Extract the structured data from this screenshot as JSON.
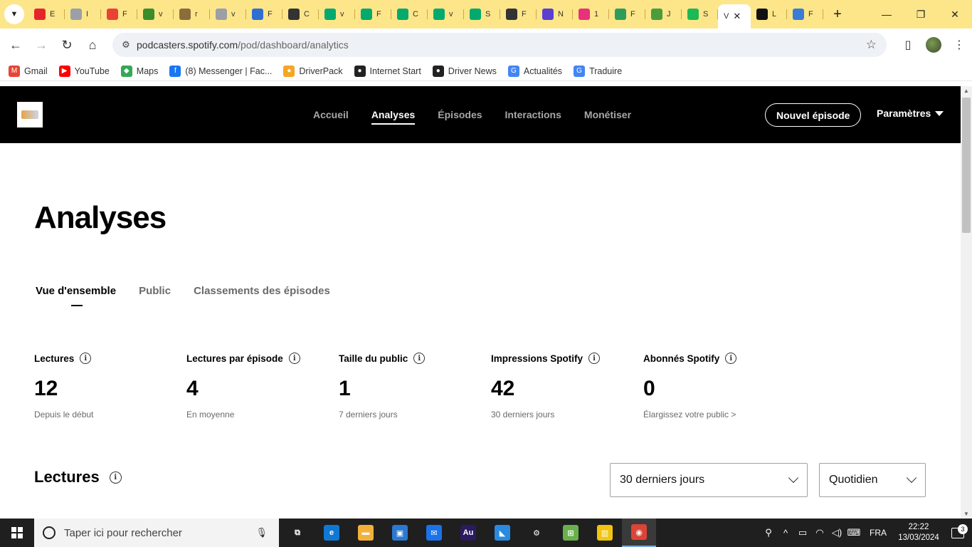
{
  "browser": {
    "tabs": [
      {
        "letter": "E",
        "color": "#e4262b"
      },
      {
        "letter": "I",
        "color": "#9aa0a6"
      },
      {
        "letter": "F",
        "color": "#ea4335"
      },
      {
        "letter": "v",
        "color": "#3a8d2a"
      },
      {
        "letter": "r",
        "color": "#8a6d3b"
      },
      {
        "letter": "v",
        "color": "#9aa0a6"
      },
      {
        "letter": "F",
        "color": "#2f6fd1"
      },
      {
        "letter": "C",
        "color": "#333333"
      },
      {
        "letter": "v",
        "color": "#04aa6d"
      },
      {
        "letter": "F",
        "color": "#04aa6d"
      },
      {
        "letter": "C",
        "color": "#04aa6d"
      },
      {
        "letter": "v",
        "color": "#04aa6d"
      },
      {
        "letter": "S",
        "color": "#04aa6d"
      },
      {
        "letter": "F",
        "color": "#333333"
      },
      {
        "letter": "N",
        "color": "#5b3fd1"
      },
      {
        "letter": "1",
        "color": "#e8317a"
      },
      {
        "letter": "F",
        "color": "#2e9d5c"
      },
      {
        "letter": "J",
        "color": "#4a9d3a"
      },
      {
        "letter": "S",
        "color": "#1db954"
      }
    ],
    "active_tab": {
      "letter": "V"
    },
    "tabs_after": [
      {
        "letter": "L",
        "color": "#111111"
      },
      {
        "letter": "F",
        "color": "#3a7bd5"
      }
    ],
    "url_domain": "podcasters.spotify.com",
    "url_path": "/pod/dashboard/analytics",
    "bookmarks": [
      {
        "label": "Gmail",
        "color": "#ea4335",
        "glyph": "M"
      },
      {
        "label": "YouTube",
        "color": "#ff0000",
        "glyph": "▶"
      },
      {
        "label": "Maps",
        "color": "#34a853",
        "glyph": "◆"
      },
      {
        "label": "(8) Messenger | Fac...",
        "color": "#1877f2",
        "glyph": "f"
      },
      {
        "label": "DriverPack",
        "color": "#f5a623",
        "glyph": "●"
      },
      {
        "label": "Internet Start",
        "color": "#222222",
        "glyph": "●"
      },
      {
        "label": "Driver News",
        "color": "#222222",
        "glyph": "●"
      },
      {
        "label": "Actualités",
        "color": "#4285f4",
        "glyph": "G"
      },
      {
        "label": "Traduire",
        "color": "#4285f4",
        "glyph": "G"
      }
    ]
  },
  "header": {
    "nav": [
      {
        "label": "Accueil",
        "active": false
      },
      {
        "label": "Analyses",
        "active": true
      },
      {
        "label": "Épisodes",
        "active": false
      },
      {
        "label": "Interactions",
        "active": false
      },
      {
        "label": "Monétiser",
        "active": false
      }
    ],
    "new_episode": "Nouvel épisode",
    "settings": "Paramètres"
  },
  "page": {
    "title": "Analyses",
    "subtabs": [
      {
        "label": "Vue d'ensemble",
        "active": true
      },
      {
        "label": "Public",
        "active": false
      },
      {
        "label": "Classements des épisodes",
        "active": false
      }
    ],
    "stats": [
      {
        "label": "Lectures",
        "value": "12",
        "sub": "Depuis le début"
      },
      {
        "label": "Lectures par épisode",
        "value": "4",
        "sub": "En moyenne"
      },
      {
        "label": "Taille du public",
        "value": "1",
        "sub": "7 derniers jours"
      },
      {
        "label": "Impressions Spotify",
        "value": "42",
        "sub": "30 derniers jours"
      },
      {
        "label": "Abonnés Spotify",
        "value": "0",
        "sub": "Élargissez votre public >"
      }
    ],
    "section_title": "Lectures",
    "range_select": "30 derniers jours",
    "freq_select": "Quotidien"
  },
  "taskbar": {
    "search_placeholder": "Taper ici pour rechercher",
    "apps": [
      {
        "name": "task-view-icon",
        "color": "#1f1f1f",
        "glyph": "⧉"
      },
      {
        "name": "edge-icon",
        "color": "#0f78d4",
        "glyph": "e"
      },
      {
        "name": "file-explorer-icon",
        "color": "#f2b23a",
        "glyph": "▬"
      },
      {
        "name": "store-icon",
        "color": "#2b78d0",
        "glyph": "▣"
      },
      {
        "name": "mail-icon",
        "color": "#1a73e8",
        "glyph": "✉"
      },
      {
        "name": "audition-icon",
        "color": "#2b1a5e",
        "glyph": "Au"
      },
      {
        "name": "vscode-icon",
        "color": "#2a8ae0",
        "glyph": "◣"
      },
      {
        "name": "settings-icon",
        "color": "#1f1f1f",
        "glyph": "⚙"
      },
      {
        "name": "green-app-icon",
        "color": "#6ab04c",
        "glyph": "⊞"
      },
      {
        "name": "yellow-app-icon",
        "color": "#f1c40f",
        "glyph": "▥"
      },
      {
        "name": "chrome-icon",
        "color": "#db4437",
        "glyph": "◉"
      }
    ],
    "language": "FRA",
    "time": "22:22",
    "date": "13/03/2024",
    "notifications": "3"
  }
}
